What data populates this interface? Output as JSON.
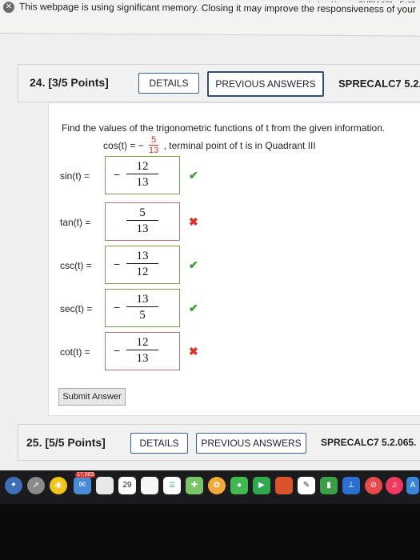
{
  "browser": {
    "tab_fragment": "vada, Las Vegas - CHEM 121 - Fall2",
    "memory_warning": "This webpage is using significant memory. Closing it may improve the responsiveness of your"
  },
  "q24": {
    "title": "24. [3/5 Points]",
    "details_label": "DETAILS",
    "previous_answers_label": "PREVIOUS ANSWERS",
    "course_code": "SPRECALC7 5.2.",
    "prompt": "Find the values of the trigonometric functions of t from the given information.",
    "given": {
      "lhs": "cos(t)  =  −",
      "num": "5",
      "den": "13",
      "rhs": ", terminal point of t is in Quadrant III"
    },
    "rows": [
      {
        "label": "sin(t)  =",
        "sign": "−",
        "num": "12",
        "den": "13",
        "correct": true
      },
      {
        "label": "tan(t)  =",
        "sign": "",
        "num": "5",
        "den": "13",
        "correct": false
      },
      {
        "label": "csc(t)  =",
        "sign": "−",
        "num": "13",
        "den": "12",
        "correct": true
      },
      {
        "label": "sec(t)  =",
        "sign": "−",
        "num": "13",
        "den": "5",
        "correct": true
      },
      {
        "label": "cot(t)  =",
        "sign": "−",
        "num": "12",
        "den": "13",
        "correct": false
      }
    ],
    "submit_label": "Submit Answer"
  },
  "q25": {
    "title": "25. [5/5 Points]",
    "details_label": "DETAILS",
    "previous_answers_label": "PREVIOUS ANSWERS",
    "course_code": "SPRECALC7 5.2.065."
  },
  "dock": {
    "mail_badge": "17,063",
    "calendar_day": "29"
  }
}
